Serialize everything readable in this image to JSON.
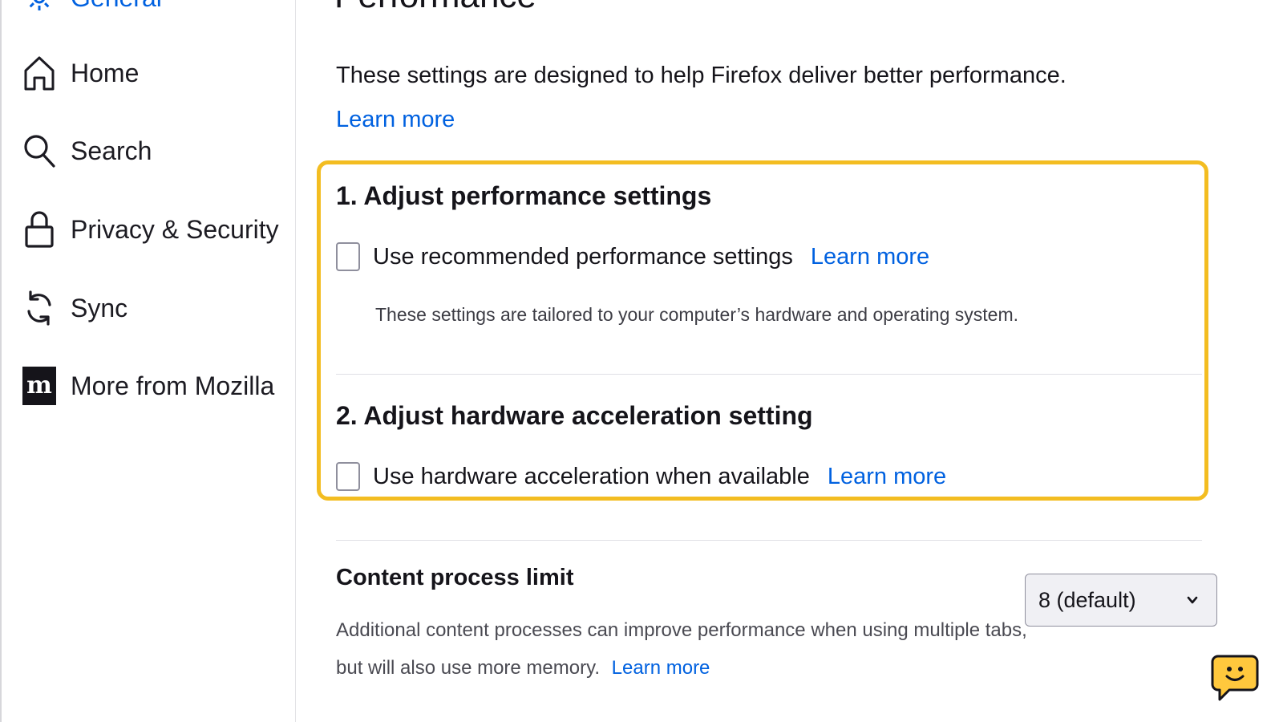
{
  "sidebar": {
    "items": [
      {
        "label": "General",
        "icon": "gear-icon",
        "active": true
      },
      {
        "label": "Home",
        "icon": "home-icon"
      },
      {
        "label": "Search",
        "icon": "search-icon"
      },
      {
        "label": "Privacy & Security",
        "icon": "lock-icon"
      },
      {
        "label": "Sync",
        "icon": "sync-icon"
      },
      {
        "label": "More from Mozilla",
        "icon": "mozilla-icon"
      }
    ]
  },
  "main": {
    "title": "Performance",
    "intro": "These settings are designed to help Firefox deliver better performance.",
    "intro_link": "Learn more",
    "section1": {
      "heading": "1. Adjust performance settings",
      "checkbox_label": "Use recommended performance settings",
      "checked": false,
      "link": "Learn more",
      "helper": "These settings are tailored to your computer’s hardware and operating system."
    },
    "section2": {
      "heading": "2. Adjust hardware acceleration setting",
      "checkbox_label": "Use hardware acceleration when available",
      "checked": false,
      "link": "Learn more"
    },
    "content_process": {
      "heading": "Content process limit",
      "desc_line1": "Additional content processes can improve performance when using multiple tabs,",
      "desc_line2": "but will also use more memory.",
      "link": "Learn more",
      "select_value": "8 (default)"
    }
  },
  "colors": {
    "accent": "#0061e0",
    "highlight": "#f3bd21",
    "support_bubble": "#ffc83d"
  }
}
